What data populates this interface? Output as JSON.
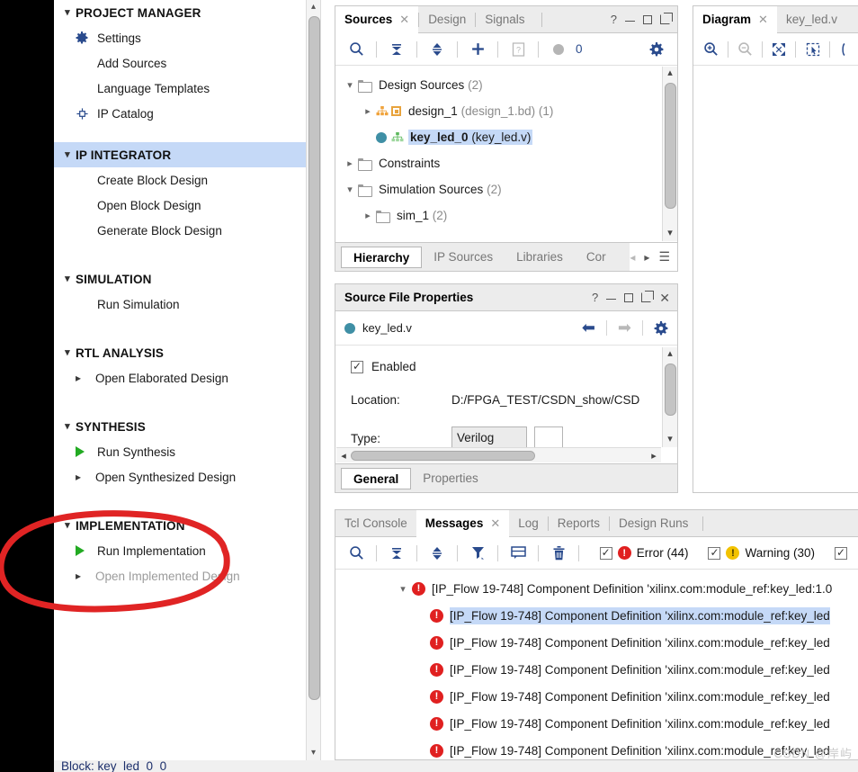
{
  "sidebar": {
    "sections": [
      {
        "title": "PROJECT MANAGER",
        "highlight": false,
        "items": [
          {
            "label": "Settings",
            "icon": "gear-icon",
            "muted": false,
            "arrow": false
          },
          {
            "label": "Add Sources",
            "icon": "none",
            "muted": false,
            "arrow": false
          },
          {
            "label": "Language Templates",
            "icon": "none",
            "muted": false,
            "arrow": false
          },
          {
            "label": "IP Catalog",
            "icon": "ip-catalog-icon",
            "muted": false,
            "arrow": false
          }
        ]
      },
      {
        "title": "IP INTEGRATOR",
        "highlight": true,
        "items": [
          {
            "label": "Create Block Design",
            "icon": "none",
            "muted": false,
            "arrow": false
          },
          {
            "label": "Open Block Design",
            "icon": "none",
            "muted": false,
            "arrow": false
          },
          {
            "label": "Generate Block Design",
            "icon": "none",
            "muted": false,
            "arrow": false
          }
        ]
      },
      {
        "title": "SIMULATION",
        "highlight": false,
        "items": [
          {
            "label": "Run Simulation",
            "icon": "none",
            "muted": false,
            "arrow": false
          }
        ]
      },
      {
        "title": "RTL ANALYSIS",
        "highlight": false,
        "items": [
          {
            "label": "Open Elaborated Design",
            "icon": "none",
            "muted": false,
            "arrow": true
          }
        ]
      },
      {
        "title": "SYNTHESIS",
        "highlight": false,
        "items": [
          {
            "label": "Run Synthesis",
            "icon": "play-icon",
            "muted": false,
            "arrow": false
          },
          {
            "label": "Open Synthesized Design",
            "icon": "none",
            "muted": false,
            "arrow": true
          }
        ]
      },
      {
        "title": "IMPLEMENTATION",
        "highlight": false,
        "items": [
          {
            "label": "Run Implementation",
            "icon": "play-icon",
            "muted": false,
            "arrow": false
          },
          {
            "label": "Open Implemented Design",
            "icon": "none",
            "muted": true,
            "arrow": true
          }
        ]
      }
    ]
  },
  "sources_panel": {
    "tabs": [
      {
        "label": "Sources",
        "active": true,
        "closable": true
      },
      {
        "label": "Design",
        "active": false,
        "closable": false
      },
      {
        "label": "Signals",
        "active": false,
        "closable": false
      }
    ],
    "window_buttons": [
      "help",
      "minimize",
      "maximize",
      "float"
    ],
    "toolbar": {
      "icons": [
        "search-icon",
        "collapse-all-icon",
        "expand-all-icon",
        "add-icon",
        "report-icon"
      ],
      "counter_label": "0",
      "settings_icon": "gear-icon"
    },
    "tree": [
      {
        "depth": 0,
        "chevron": "down",
        "icon": "folder-icon",
        "name": "Design Sources",
        "suffix": "(2)",
        "selected": false,
        "bold": false
      },
      {
        "depth": 1,
        "chevron": "right",
        "icon": "block-design-icon",
        "name": "design_1",
        "suffix": "(design_1.bd) (1)",
        "selected": false,
        "bold": false
      },
      {
        "depth": 1,
        "chevron": "none",
        "icon": "module-icon",
        "name": "key_led_0",
        "suffix": "(key_led.v)",
        "selected": true,
        "bold": true
      },
      {
        "depth": 0,
        "chevron": "right",
        "icon": "folder-icon",
        "name": "Constraints",
        "suffix": "",
        "selected": false,
        "bold": false
      },
      {
        "depth": 0,
        "chevron": "down",
        "icon": "folder-icon",
        "name": "Simulation Sources",
        "suffix": "(2)",
        "selected": false,
        "bold": false
      },
      {
        "depth": 1,
        "chevron": "right",
        "icon": "folder-icon",
        "name": "sim_1",
        "suffix": "(2)",
        "selected": false,
        "bold": false
      }
    ],
    "bottom_tabs": [
      {
        "label": "Hierarchy",
        "active": true
      },
      {
        "label": "IP Sources",
        "active": false
      },
      {
        "label": "Libraries",
        "active": false
      },
      {
        "label": "Cor",
        "active": false
      }
    ],
    "bottom_tail_icons": [
      "prev-icon",
      "next-icon",
      "menu-icon"
    ]
  },
  "properties_panel": {
    "title": "Source File Properties",
    "window_buttons": [
      "help",
      "minimize",
      "maximize",
      "float",
      "close"
    ],
    "file_name": "key_led.v",
    "nav_icons": [
      "back-icon",
      "forward-icon",
      "gear-icon"
    ],
    "enabled_label": "Enabled",
    "enabled_checked": true,
    "rows": [
      {
        "key": "Location:",
        "value": "D:/FPGA_TEST/CSDN_show/CSD"
      },
      {
        "key": "Type:",
        "value": "Verilog"
      }
    ],
    "bottom_tabs": [
      {
        "label": "General",
        "active": true
      },
      {
        "label": "Properties",
        "active": false
      }
    ]
  },
  "diagram_panel": {
    "tabs": [
      {
        "label": "Diagram",
        "active": true,
        "closable": true
      },
      {
        "label": "key_led.v",
        "active": false,
        "closable": false
      }
    ],
    "toolbar_icons": [
      "zoom-in-icon",
      "zoom-out-icon",
      "fit-screen-icon",
      "select-area-icon",
      "zoom-region-icon"
    ]
  },
  "messages_panel": {
    "tabs": [
      {
        "label": "Tcl Console",
        "active": false,
        "closable": false
      },
      {
        "label": "Messages",
        "active": true,
        "closable": true
      },
      {
        "label": "Log",
        "active": false,
        "closable": false
      },
      {
        "label": "Reports",
        "active": false,
        "closable": false
      },
      {
        "label": "Design Runs",
        "active": false,
        "closable": false
      }
    ],
    "toolbar_icons": [
      "search-icon",
      "collapse-all-icon",
      "expand-all-icon",
      "filter-icon",
      "comment-icon",
      "delete-icon"
    ],
    "filters": [
      {
        "label": "Error (44)",
        "severity": "error",
        "glyph": "!",
        "checked": true
      },
      {
        "label": "Warning (30)",
        "severity": "warning",
        "glyph": "!",
        "checked": true
      },
      {
        "label": "",
        "severity": "other",
        "glyph": "",
        "checked": true
      }
    ],
    "rows": [
      {
        "indent": 0,
        "chevron": "down",
        "text": "[IP_Flow 19-748] Component Definition 'xilinx.com:module_ref:key_led:1.0",
        "selected": false
      },
      {
        "indent": 1,
        "chevron": "none",
        "text": "[IP_Flow 19-748] Component Definition 'xilinx.com:module_ref:key_led",
        "selected": true
      },
      {
        "indent": 1,
        "chevron": "none",
        "text": "[IP_Flow 19-748] Component Definition 'xilinx.com:module_ref:key_led",
        "selected": false
      },
      {
        "indent": 1,
        "chevron": "none",
        "text": "[IP_Flow 19-748] Component Definition 'xilinx.com:module_ref:key_led",
        "selected": false
      },
      {
        "indent": 1,
        "chevron": "none",
        "text": "[IP_Flow 19-748] Component Definition 'xilinx.com:module_ref:key_led",
        "selected": false
      },
      {
        "indent": 1,
        "chevron": "none",
        "text": "[IP_Flow 19-748] Component Definition 'xilinx.com:module_ref:key_led",
        "selected": false
      },
      {
        "indent": 1,
        "chevron": "none",
        "text": "[IP_Flow 19-748] Component Definition 'xilinx.com:module_ref:key_led",
        "selected": false
      }
    ]
  },
  "statusbar": {
    "text": "Block: key_led_0_0"
  },
  "watermark": {
    "text": "CSDN @岸屿"
  },
  "colors": {
    "accent_blue": "#2a4b8d",
    "selection_blue": "#c5d9f7",
    "error_red": "#e02020",
    "warning_yellow": "#f2c200",
    "green_play": "#22aa22",
    "annotation_red": "#e02424"
  }
}
